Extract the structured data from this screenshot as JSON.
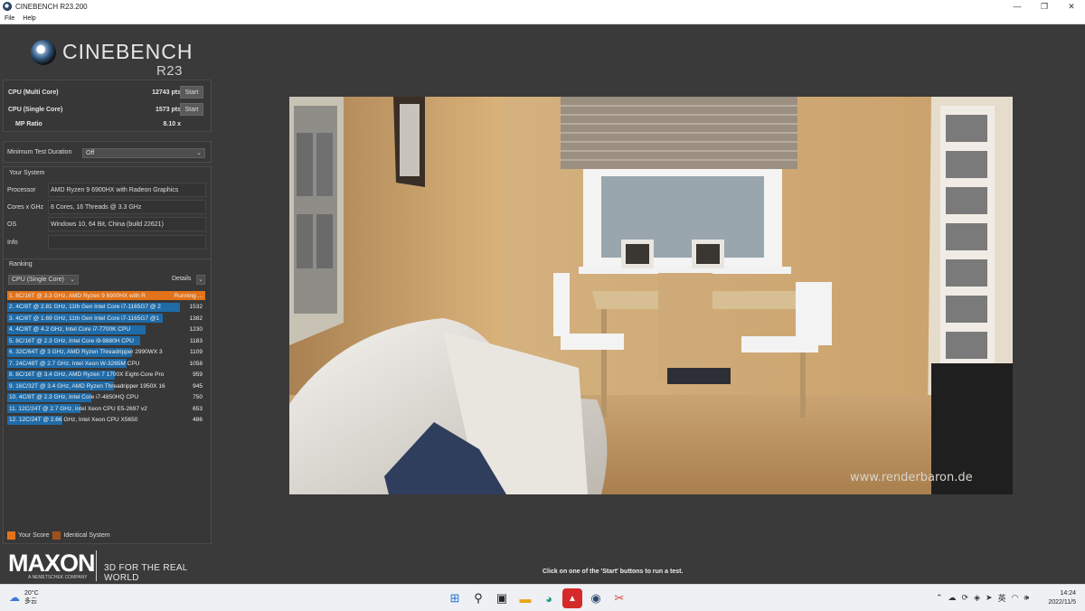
{
  "window": {
    "title": "CINEBENCH R23.200",
    "controls": [
      "—",
      "❐",
      "✕"
    ]
  },
  "menu": {
    "items": [
      "File",
      "Help"
    ]
  },
  "logo": {
    "name": "CINEBENCH",
    "version": "R23"
  },
  "scores": {
    "multi": {
      "label": "CPU (Multi Core)",
      "value": "12743 pts",
      "button": "Start"
    },
    "single": {
      "label": "CPU (Single Core)",
      "value": "1573 pts",
      "button": "Start"
    },
    "ratio": {
      "label": "MP Ratio",
      "value": "8.10 x"
    }
  },
  "min_test": {
    "label": "Minimum Test Duration",
    "value": "Off"
  },
  "system": {
    "title": "Your System",
    "processor": {
      "label": "Processor",
      "value": "AMD Ryzen 9 6900HX with Radeon Graphics"
    },
    "cores": {
      "label": "Cores x GHz",
      "value": "8 Cores, 16 Threads @ 3.3 GHz"
    },
    "os": {
      "label": "OS",
      "value": "Windows 10, 64 Bit, China (build 22621)"
    },
    "info": {
      "label": "Info",
      "value": ""
    }
  },
  "ranking": {
    "title": "Ranking",
    "filter": "CPU (Single Core)",
    "details": "Details",
    "max_score": 1573,
    "items": [
      {
        "text": "1. 8C/16T @ 3.3 GHz, AMD Ryzen 9 6900HX with R",
        "score": "Running ...",
        "value": 1573,
        "current": true
      },
      {
        "text": "2. 4C/8T @ 2.81 GHz, 11th Gen Intel Core i7-1165G7 @ 2",
        "score": "1532",
        "value": 1532,
        "current": false
      },
      {
        "text": "3. 4C/8T @ 1.69 GHz, 11th Gen Intel Core i7-1165G7 @1",
        "score": "1382",
        "value": 1382,
        "current": false
      },
      {
        "text": "4. 4C/8T @ 4.2 GHz, Intel Core i7-7700K CPU",
        "score": "1230",
        "value": 1230,
        "current": false
      },
      {
        "text": "5. 8C/16T @ 2.3 GHz, Intel Core i9-9880H CPU",
        "score": "1183",
        "value": 1183,
        "current": false
      },
      {
        "text": "6. 32C/64T @ 3 GHz, AMD Ryzen Threadripper 2990WX 3",
        "score": "1109",
        "value": 1109,
        "current": false
      },
      {
        "text": "7. 24C/48T @ 2.7 GHz, Intel Xeon W-3265M CPU",
        "score": "1058",
        "value": 1058,
        "current": false
      },
      {
        "text": "8. 8C/16T @ 3.4 GHz, AMD Ryzen 7 1700X Eight-Core Pro",
        "score": "959",
        "value": 959,
        "current": false
      },
      {
        "text": "9. 16C/32T @ 3.4 GHz, AMD Ryzen Threadripper 1950X 16",
        "score": "945",
        "value": 945,
        "current": false
      },
      {
        "text": "10. 4C/8T @ 2.3 GHz, Intel Core i7-4850HQ CPU",
        "score": "750",
        "value": 750,
        "current": false
      },
      {
        "text": "11. 12C/24T @ 2.7 GHz, Intel Xeon CPU E5-2697 v2",
        "score": "653",
        "value": 653,
        "current": false
      },
      {
        "text": "12. 12C/24T @ 2.66 GHz, Intel Xeon CPU X5650",
        "score": "486",
        "value": 486,
        "current": false
      }
    ]
  },
  "legend": {
    "your_score": "Your Score",
    "identical": "Identical System",
    "your_color": "#e2731a",
    "identical_color": "#a0521a"
  },
  "maxon": {
    "word": "MAXON",
    "sub": "A NEMETSCHEK COMPANY",
    "tagline": "3D FOR THE REAL WORLD"
  },
  "render": {
    "watermark": "www.renderbaron.de"
  },
  "hint": "Click on one of the 'Start' buttons to run a test.",
  "taskbar": {
    "weather": {
      "temp": "20°C",
      "cond": "多云"
    },
    "ime": "英",
    "time": "14:24",
    "date": "2022/11/5"
  }
}
